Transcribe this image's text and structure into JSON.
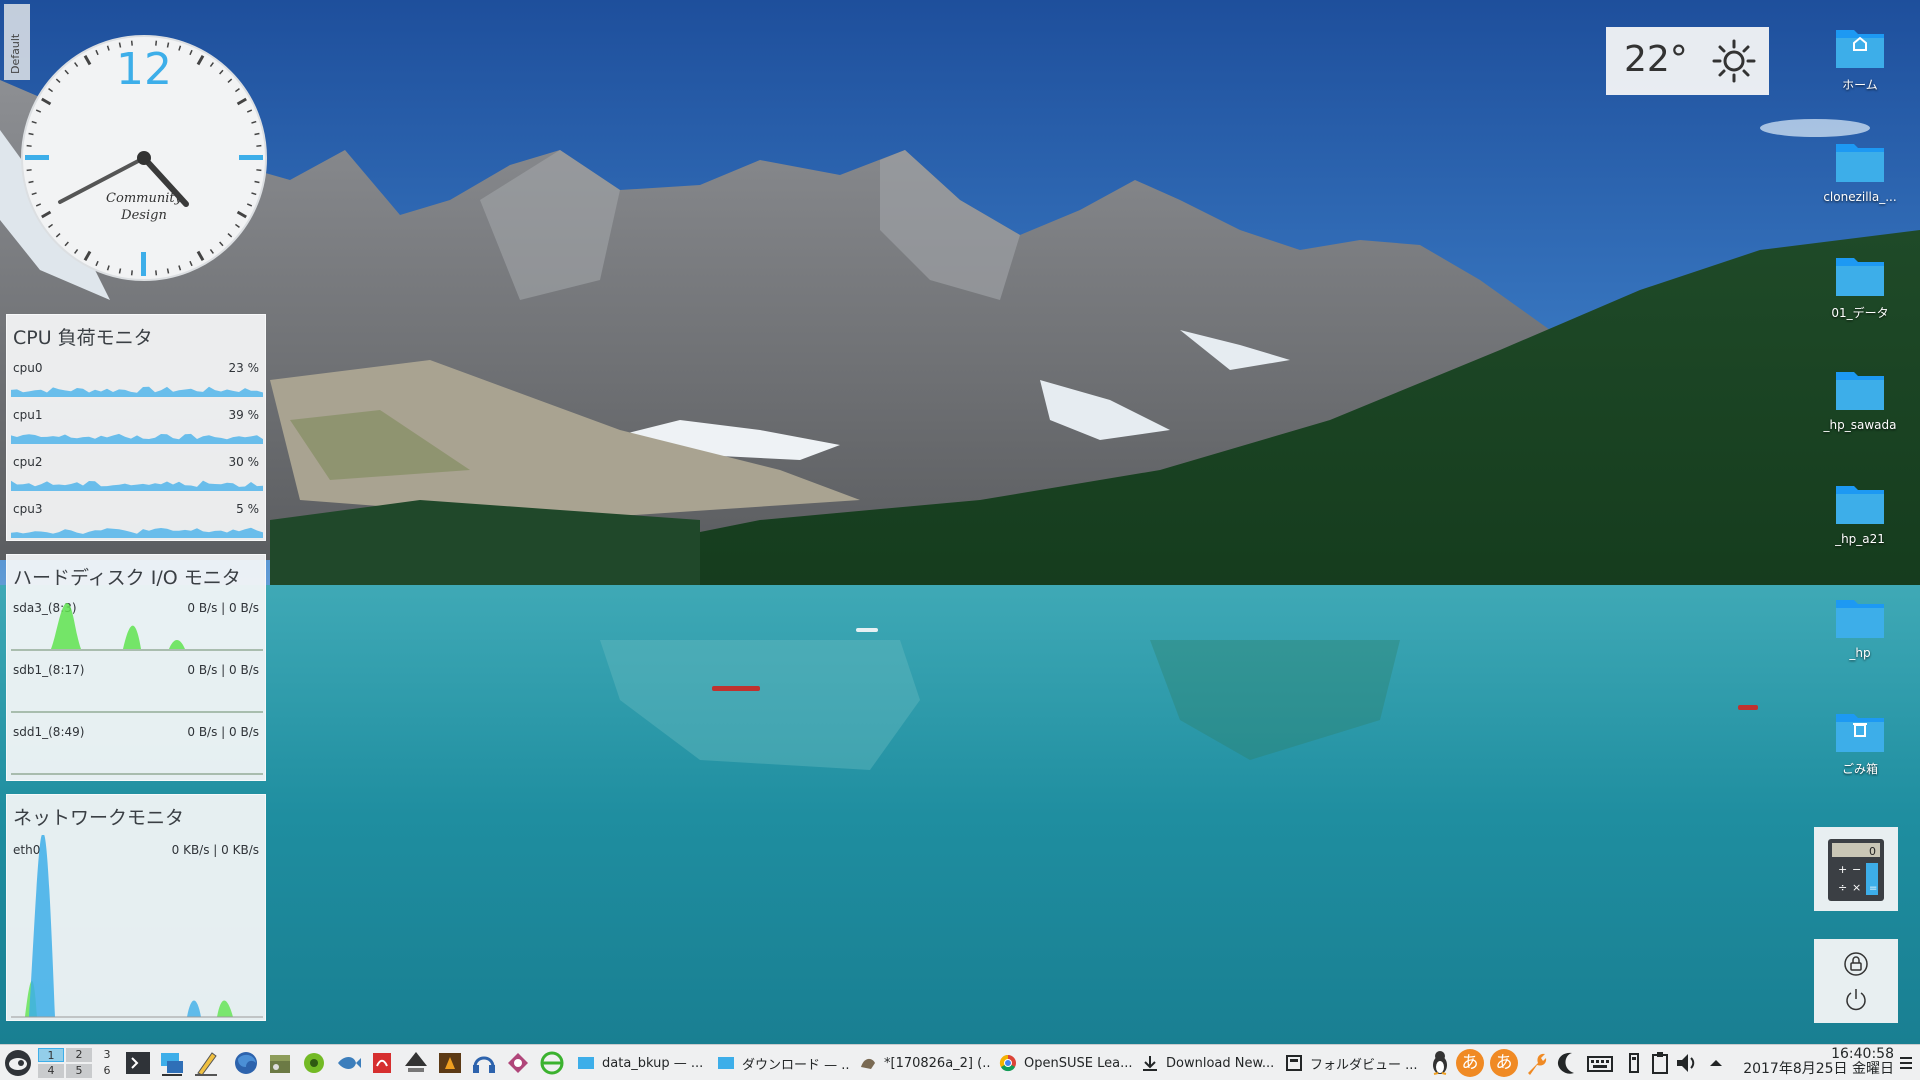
{
  "activity": {
    "label": "Default"
  },
  "clock": {
    "number": "12",
    "brand_line1": "Community",
    "brand_line2": "Design"
  },
  "weather": {
    "temperature": "22°",
    "icon": "sun-icon"
  },
  "cpu_monitor": {
    "title": "CPU 負荷モニタ",
    "rows": [
      {
        "name": "cpu0",
        "value": "23 %"
      },
      {
        "name": "cpu1",
        "value": "39 %"
      },
      {
        "name": "cpu2",
        "value": "30 %"
      },
      {
        "name": "cpu3",
        "value": "5 %"
      }
    ],
    "color": "#3daee9"
  },
  "disk_monitor": {
    "title": "ハードディスク I/O モニタ",
    "rows": [
      {
        "name": "sda3_(8:3)",
        "value": "0 B/s | 0 B/s"
      },
      {
        "name": "sdb1_(8:17)",
        "value": "0 B/s | 0 B/s"
      },
      {
        "name": "sdd1_(8:49)",
        "value": "0 B/s | 0 B/s"
      }
    ],
    "color": "#5fe34f"
  },
  "network_monitor": {
    "title": "ネットワークモニタ",
    "rows": [
      {
        "name": "eth0",
        "value": "0 KB/s | 0 KB/s"
      }
    ]
  },
  "desktop_icons": [
    {
      "label": "ホーム",
      "icon": "home-folder-icon"
    },
    {
      "label": "clonezilla_...",
      "icon": "folder-icon"
    },
    {
      "label": "01_データ",
      "icon": "folder-icon"
    },
    {
      "label": "_hp_sawada",
      "icon": "folder-icon"
    },
    {
      "label": "_hp_a21",
      "icon": "folder-icon"
    },
    {
      "label": "_hp",
      "icon": "folder-icon"
    },
    {
      "label": "ごみ箱",
      "icon": "trash-icon"
    }
  ],
  "calculator": {
    "display": "0",
    "keys": [
      "+",
      "−",
      "÷",
      "×",
      "="
    ]
  },
  "taskbar": {
    "pager": [
      "1",
      "2",
      "3",
      "4",
      "5",
      "6"
    ],
    "tasks": [
      {
        "label": "data_bkup — ...",
        "icon": "folder-icon"
      },
      {
        "label": "ダウンロード — ...",
        "icon": "folder-icon"
      },
      {
        "label": "*[170826a_2] (...",
        "icon": "gimp-icon"
      },
      {
        "label": "OpenSUSE Lea...",
        "icon": "chrome-icon"
      },
      {
        "label": "Download New...",
        "icon": "download-icon"
      },
      {
        "label": "フォルダビュー ...",
        "icon": "folder-view-icon"
      }
    ],
    "tray_input_1": "あ",
    "tray_input_2": "あ",
    "time": "16:40:58",
    "date": "2017年8月25日 金曜日"
  },
  "colors": {
    "accent": "#3daee9",
    "disk_green": "#5fe34f",
    "panel_bg": "#f3f4f5",
    "taskbar_bg": "#eff0f1"
  }
}
